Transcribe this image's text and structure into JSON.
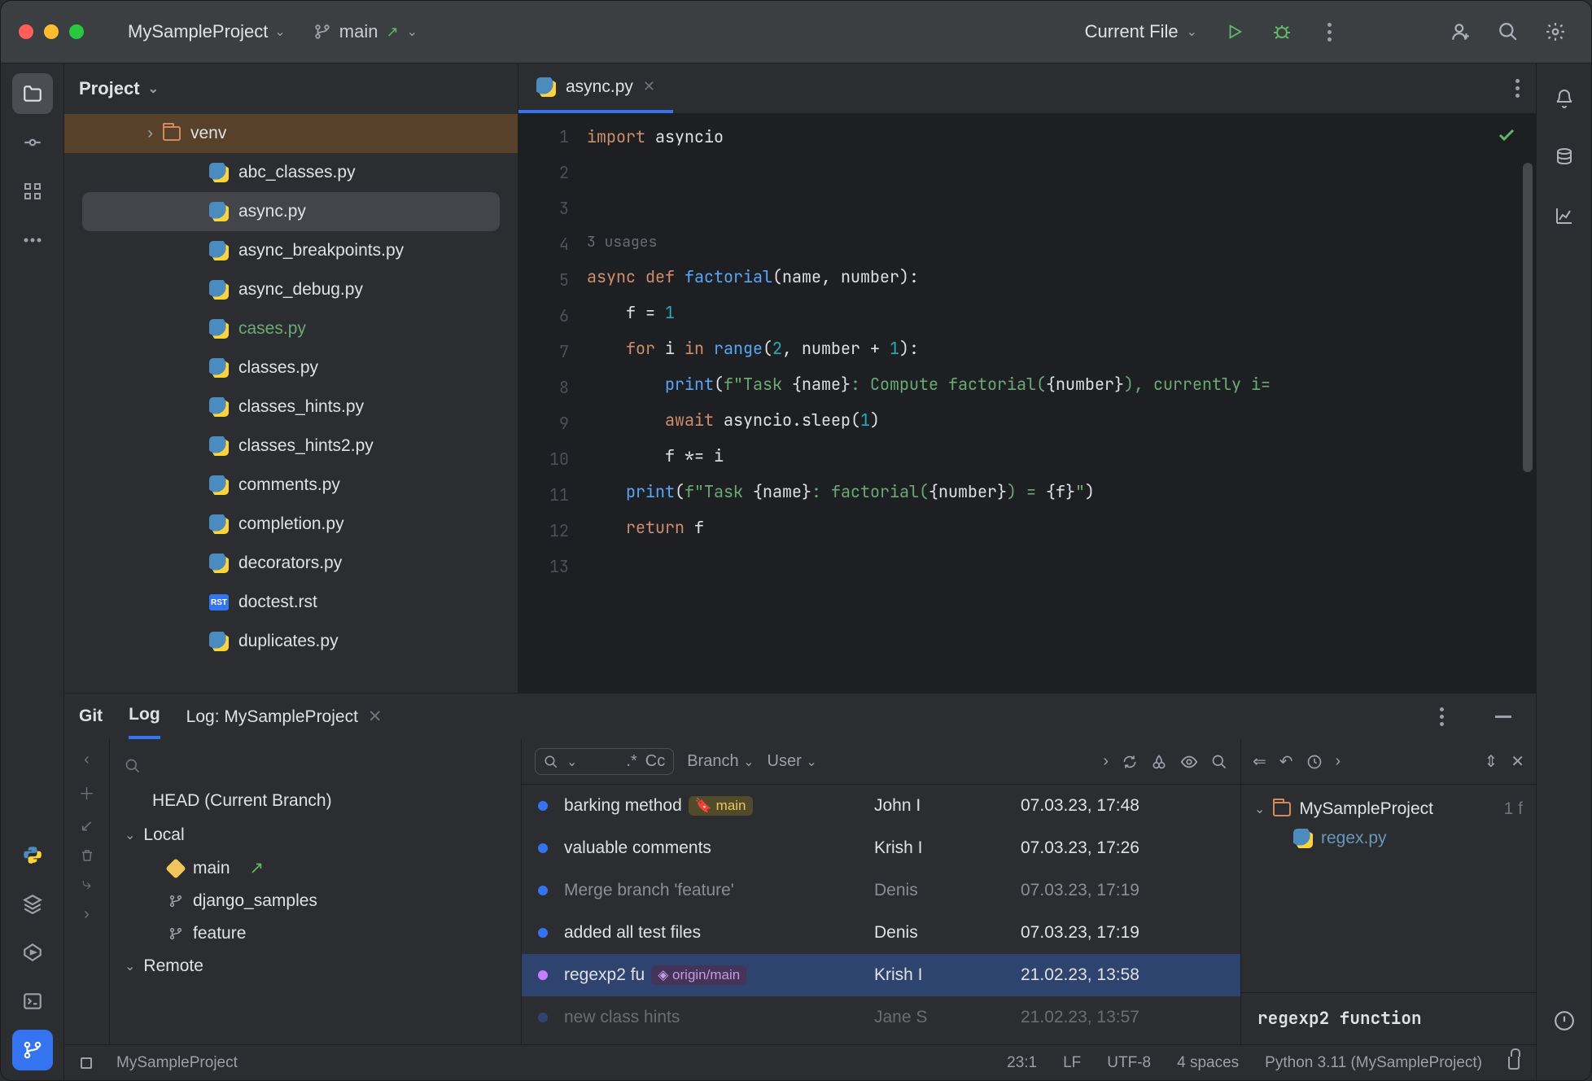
{
  "titlebar": {
    "project": "MySampleProject",
    "branch": "main",
    "run_config": "Current File"
  },
  "project_tool": {
    "title": "Project",
    "venv": "venv",
    "files": [
      {
        "name": "abc_classes.py",
        "sel": false,
        "green": false
      },
      {
        "name": "async.py",
        "sel": true,
        "green": false
      },
      {
        "name": "async_breakpoints.py",
        "sel": false,
        "green": false
      },
      {
        "name": "async_debug.py",
        "sel": false,
        "green": false
      },
      {
        "name": "cases.py",
        "sel": false,
        "green": true
      },
      {
        "name": "classes.py",
        "sel": false,
        "green": false
      },
      {
        "name": "classes_hints.py",
        "sel": false,
        "green": false
      },
      {
        "name": "classes_hints2.py",
        "sel": false,
        "green": false
      },
      {
        "name": "comments.py",
        "sel": false,
        "green": false
      },
      {
        "name": "completion.py",
        "sel": false,
        "green": false
      },
      {
        "name": "decorators.py",
        "sel": false,
        "green": false
      },
      {
        "name": "doctest.rst",
        "sel": false,
        "green": false,
        "rst": true
      },
      {
        "name": "duplicates.py",
        "sel": false,
        "green": false
      }
    ]
  },
  "editor": {
    "tab": "async.py",
    "usages": "3 usages",
    "gutter": [
      "1",
      "2",
      "3",
      "",
      "4",
      "5",
      "6",
      "7",
      "8",
      "9",
      "10",
      "11",
      "12",
      "13"
    ]
  },
  "git": {
    "tab_git": "Git",
    "tab_log": "Log",
    "tab_logproj": "Log: MySampleProject",
    "branches": {
      "head": "HEAD (Current Branch)",
      "local": "Local",
      "remote": "Remote",
      "items": [
        {
          "name": "main",
          "tag": true,
          "ext": true
        },
        {
          "name": "django_samples",
          "tag": false
        },
        {
          "name": "feature",
          "tag": false
        }
      ]
    },
    "toolbar": {
      "regex": ".*",
      "cc": "Cc",
      "branch": "Branch",
      "user": "User"
    },
    "commits": [
      {
        "msg": "barking method",
        "chip": "main",
        "chipkind": "main",
        "author": "John I",
        "date": "07.03.23, 17:48"
      },
      {
        "msg": "valuable comments",
        "author": "Krish I",
        "date": "07.03.23, 17:26"
      },
      {
        "msg": "Merge branch 'feature'",
        "author": "Denis",
        "date": "07.03.23, 17:19",
        "merge": true
      },
      {
        "msg": "added all test files",
        "author": "Denis",
        "date": "07.03.23, 17:19"
      },
      {
        "msg": "regexp2 fu",
        "chip": "origin/main",
        "chipkind": "origin",
        "author": "Krish I",
        "date": "21.02.23, 13:58",
        "sel": true
      },
      {
        "msg": "new class hints",
        "author": "Jane S",
        "date": "21.02.23, 13:57",
        "cut": true
      }
    ],
    "detail": {
      "project": "MySampleProject",
      "count": "1 f",
      "file": "regex.py",
      "message": "regexp2 function"
    }
  },
  "status": {
    "project": "MySampleProject",
    "pos": "23:1",
    "sep": "LF",
    "enc": "UTF-8",
    "indent": "4 spaces",
    "interp": "Python 3.11 (MySampleProject)"
  }
}
